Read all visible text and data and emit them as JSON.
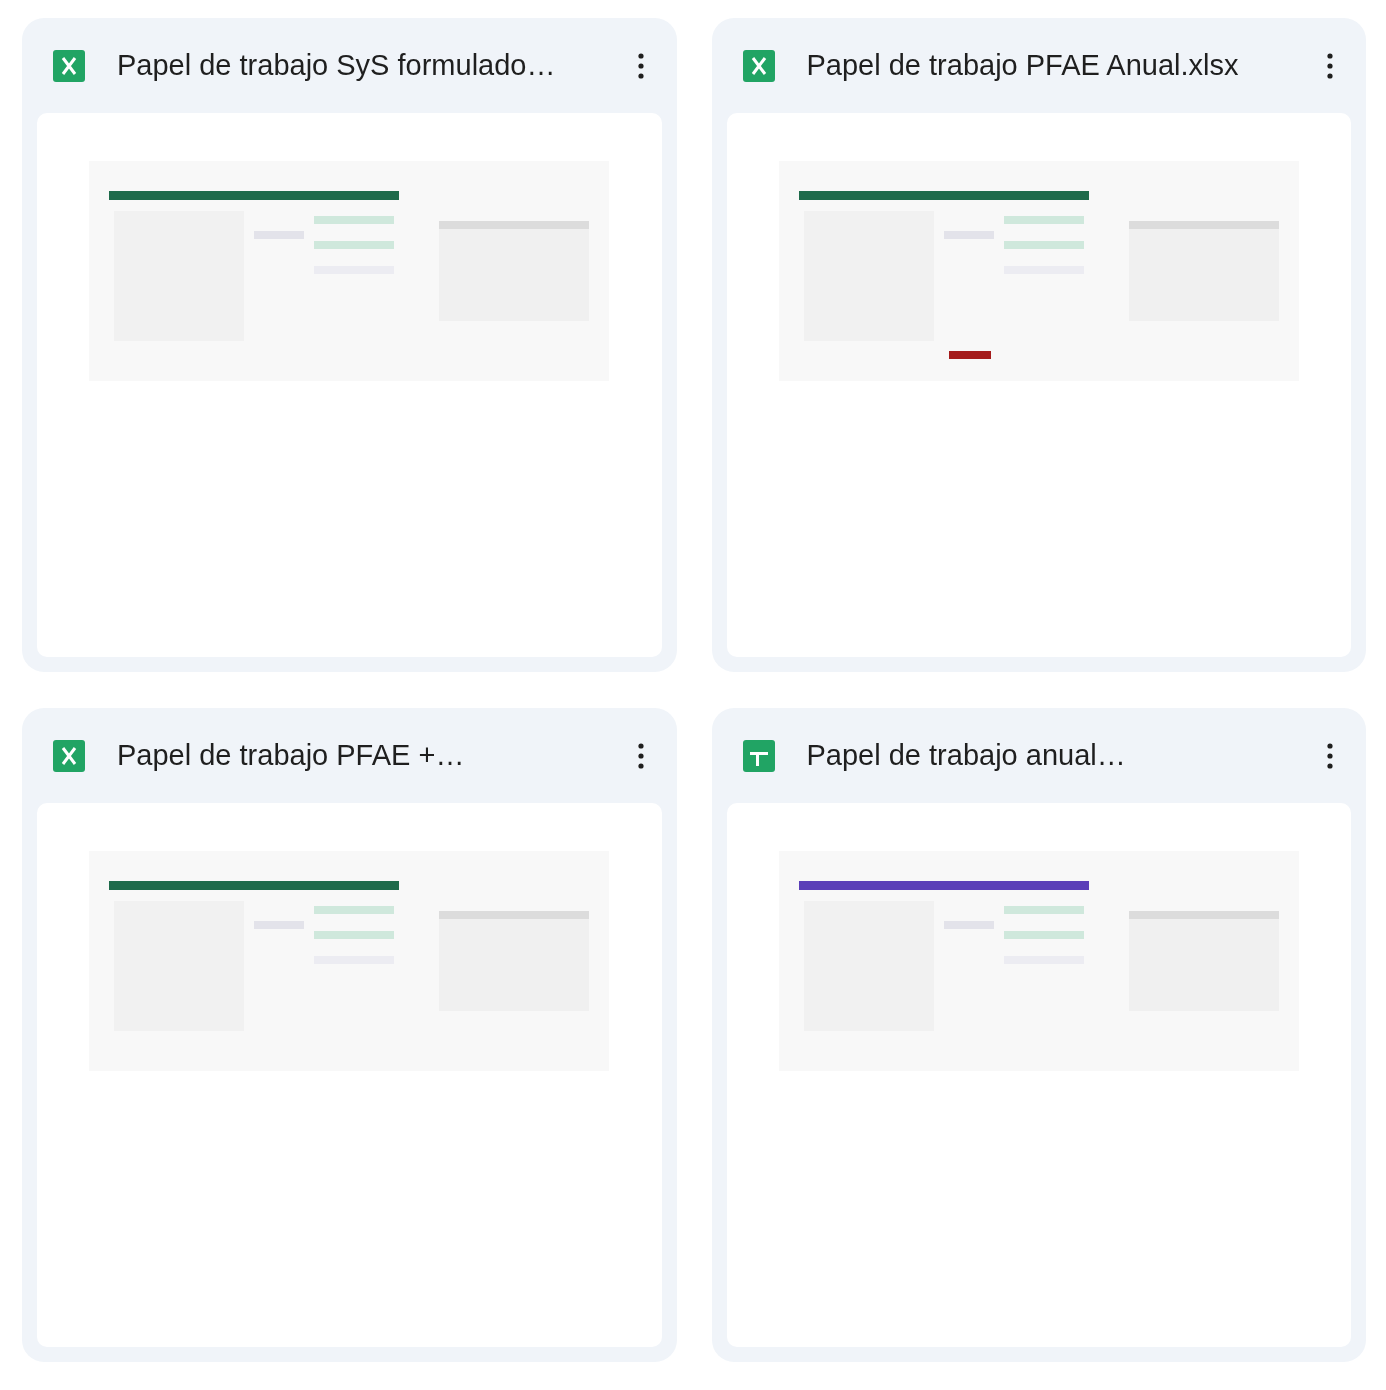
{
  "files": [
    {
      "name": "Papel de trabajo SyS formulado…",
      "kind": "excel"
    },
    {
      "name": "Papel de trabajo PFAE Anual.xlsx",
      "kind": "excel"
    },
    {
      "name": "Papel de trabajo PFAE +…",
      "kind": "excel"
    },
    {
      "name": "Papel de trabajo anual…",
      "kind": "sheets"
    }
  ]
}
